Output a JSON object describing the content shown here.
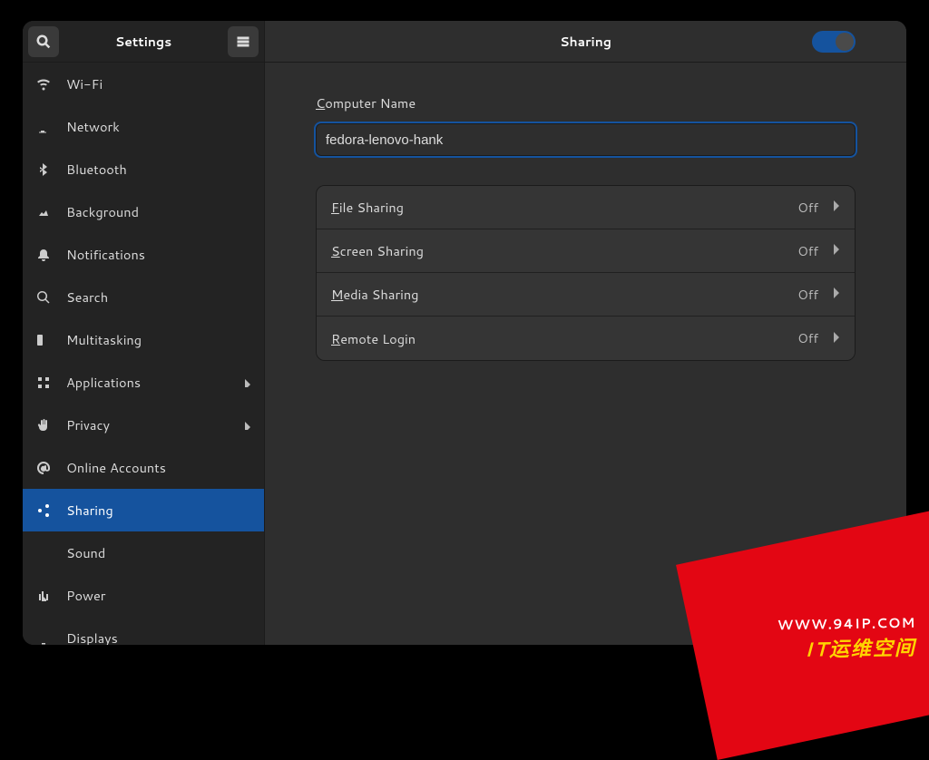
{
  "app": {
    "title": "Settings",
    "panel_title": "Sharing"
  },
  "sharing": {
    "master_enabled": true,
    "computer_name_label_pre": "C",
    "computer_name_label_post": "omputer Name",
    "computer_name_value": "fedora-lenovo-hank",
    "rows": [
      {
        "key_pre": "F",
        "key_post": "ile Sharing",
        "status": "Off"
      },
      {
        "key_pre": "S",
        "key_post": "creen Sharing",
        "status": "Off"
      },
      {
        "key_pre": "M",
        "key_post": "edia Sharing",
        "status": "Off"
      },
      {
        "key_pre": "R",
        "key_post": "emote Login",
        "status": "Off"
      }
    ]
  },
  "sidebar": {
    "items": [
      {
        "label": "Wi-Fi",
        "icon": "wifi",
        "chevron": false
      },
      {
        "label": "Network",
        "icon": "network",
        "chevron": false
      },
      {
        "label": "Bluetooth",
        "icon": "bluetooth",
        "chevron": false
      },
      {
        "label": "Background",
        "icon": "background",
        "chevron": false
      },
      {
        "label": "Notifications",
        "icon": "bell",
        "chevron": false
      },
      {
        "label": "Search",
        "icon": "search",
        "chevron": false
      },
      {
        "label": "Multitasking",
        "icon": "multitasking",
        "chevron": false
      },
      {
        "label": "Applications",
        "icon": "apps",
        "chevron": true
      },
      {
        "label": "Privacy",
        "icon": "hand",
        "chevron": true
      },
      {
        "label": "Online Accounts",
        "icon": "at",
        "chevron": false
      },
      {
        "label": "Sharing",
        "icon": "share",
        "chevron": false,
        "selected": true
      },
      {
        "label": "Sound",
        "icon": "speaker",
        "chevron": false
      },
      {
        "label": "Power",
        "icon": "power",
        "chevron": false
      },
      {
        "label": "Displays",
        "icon": "display",
        "chevron": false
      }
    ]
  },
  "watermark": {
    "url": "WWW.94IP.COM",
    "cn": "IT运维空间"
  }
}
